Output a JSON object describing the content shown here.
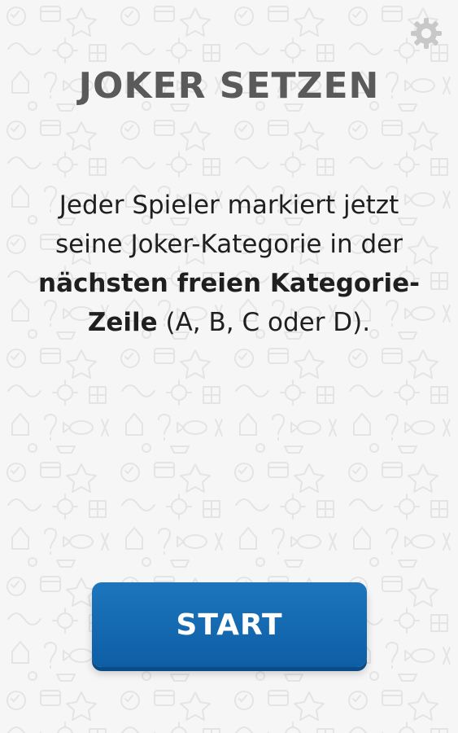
{
  "screen": {
    "title": "JOKER SETZEN",
    "instruction_part1": "Jeder Spieler markiert jetzt seine Joker-Kategorie in der ",
    "instruction_bold": "nächsten freien Kategorie-Zeile",
    "instruction_part2": " (A, B, C oder D).",
    "start_label": "START"
  },
  "icons": {
    "settings": "gear-icon"
  },
  "colors": {
    "background": "#f6f6f6",
    "title": "#5a5a5a",
    "text": "#1f1f1f",
    "button": "#1068b1",
    "button_text": "#ffffff",
    "gear": "#c8c8c8"
  }
}
